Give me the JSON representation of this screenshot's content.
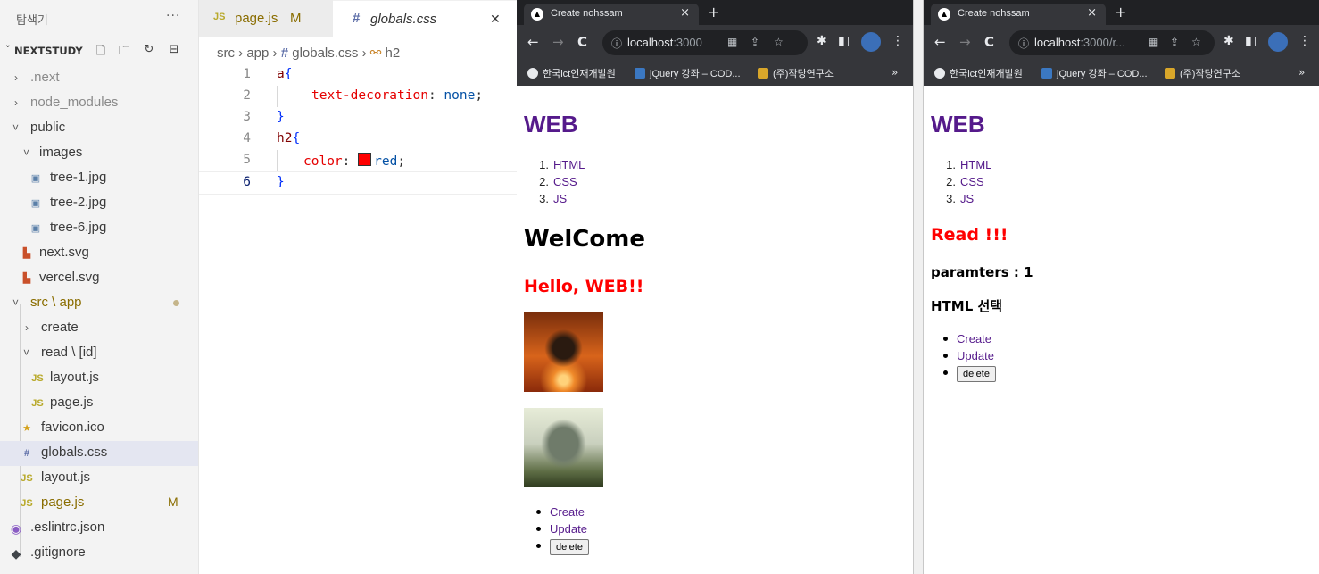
{
  "explorer": {
    "title": "탐색기",
    "more": "···",
    "project": "NEXTSTUDY",
    "items": [
      {
        "label": ".next",
        "icon": "chevron-right-icon"
      },
      {
        "label": "node_modules",
        "icon": "chevron-right-icon"
      },
      {
        "label": "public",
        "icon": "chevron-down-icon"
      },
      {
        "label": "images",
        "icon": "chevron-down-icon"
      },
      {
        "label": "tree-1.jpg",
        "icon": "image-file-icon"
      },
      {
        "label": "tree-2.jpg",
        "icon": "image-file-icon"
      },
      {
        "label": "tree-6.jpg",
        "icon": "image-file-icon"
      },
      {
        "label": "next.svg",
        "icon": "svg-file-icon"
      },
      {
        "label": "vercel.svg",
        "icon": "svg-file-icon"
      },
      {
        "label": "src \\ app",
        "icon": "chevron-down-icon"
      },
      {
        "label": "create",
        "icon": "chevron-right-icon"
      },
      {
        "label": "read \\ [id]",
        "icon": "chevron-down-icon"
      },
      {
        "label": "layout.js",
        "icon": "js-file-icon"
      },
      {
        "label": "page.js",
        "icon": "js-file-icon"
      },
      {
        "label": "favicon.ico",
        "icon": "star-icon"
      },
      {
        "label": "globals.css",
        "icon": "css-file-icon"
      },
      {
        "label": "layout.js",
        "icon": "js-file-icon"
      },
      {
        "label": "page.js",
        "icon": "js-file-icon",
        "badge": "M"
      },
      {
        "label": ".eslintrc.json",
        "icon": "settings-file-icon"
      },
      {
        "label": ".gitignore",
        "icon": "git-icon"
      }
    ]
  },
  "editor": {
    "tabs": [
      {
        "icon": "JS",
        "label": "page.js",
        "badge": "M"
      },
      {
        "icon": "#",
        "label": "globals.css",
        "close": "✕"
      }
    ],
    "breadcrumb": {
      "p1": "src",
      "sep": "›",
      "p2": "app",
      "hash": "#",
      "p3": "globals.css",
      "p4": "h2"
    },
    "lines": [
      {
        "num": "1",
        "selector": "a",
        "open": "{"
      },
      {
        "num": "2",
        "prop": "text-decoration",
        "colon": ": ",
        "value": "none",
        "semi": ";"
      },
      {
        "num": "3",
        "close": "}"
      },
      {
        "num": "4",
        "selector": "h2",
        "open": "{"
      },
      {
        "num": "5",
        "prop": "color",
        "colon": ": ",
        "value": "red",
        "semi": ";"
      },
      {
        "num": "6",
        "close": "}"
      }
    ]
  },
  "browser1": {
    "tab_title": "Create nohssam",
    "tab_close": "×",
    "new_tab": "+",
    "url_host": "localhost",
    "url_rest": ":3000",
    "bookmarks": [
      "한국ict인재개발원",
      "jQuery 강좌 – COD...",
      "(주)작당연구소"
    ],
    "more": "»",
    "page": {
      "h1": "WEB",
      "list": [
        {
          "n": "1.",
          "t": "HTML"
        },
        {
          "n": "2.",
          "t": "CSS"
        },
        {
          "n": "3.",
          "t": "JS"
        }
      ],
      "welcome": "WelCome",
      "hello": "Hello, WEB!!",
      "links": [
        "Create",
        "Update"
      ],
      "delete_label": "delete"
    }
  },
  "browser2": {
    "tab_title": "Create nohssam",
    "tab_close": "×",
    "new_tab": "+",
    "url_host": "localhost",
    "url_rest": ":3000/r...",
    "bookmarks": [
      "한국ict인재개발원",
      "jQuery 강좌 – COD...",
      "(주)작당연구소"
    ],
    "more": "»",
    "page": {
      "h1": "WEB",
      "list": [
        {
          "n": "1.",
          "t": "HTML"
        },
        {
          "n": "2.",
          "t": "CSS"
        },
        {
          "n": "3.",
          "t": "JS"
        }
      ],
      "read": "Read !!!",
      "params": "paramters : 1",
      "selected": "HTML 선택",
      "links": [
        "Create",
        "Update"
      ],
      "delete_label": "delete"
    }
  },
  "colors": {
    "link": "#551a8b",
    "red": "#ff0000",
    "modified": "#8a6d00"
  }
}
